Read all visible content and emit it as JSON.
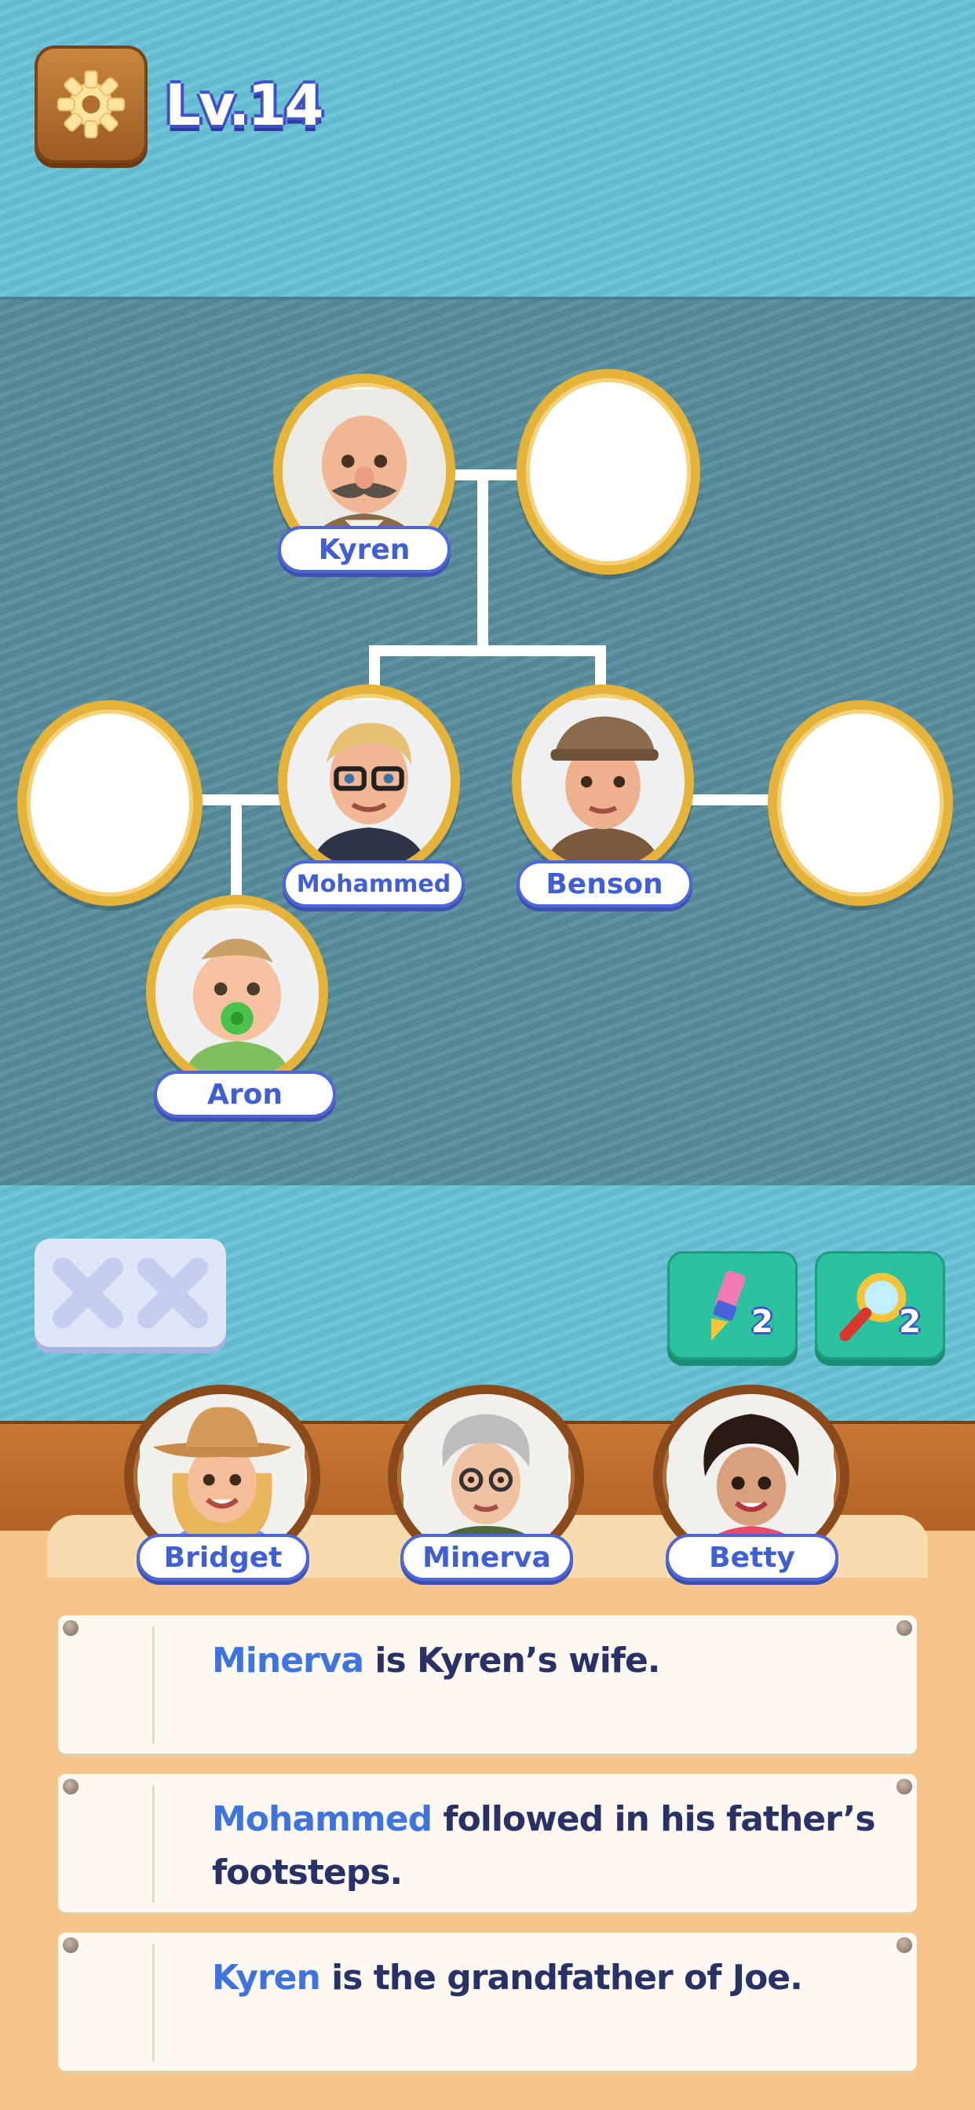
{
  "header": {
    "level": "Lv.14"
  },
  "tree": {
    "names": {
      "kyren": "Kyren",
      "mohammed": "Mohammed",
      "benson": "Benson",
      "aron": "Aron"
    }
  },
  "mistakes": {
    "marks": [
      "x",
      "x"
    ]
  },
  "tools": {
    "brush": {
      "count": "2"
    },
    "magnifier": {
      "count": "2"
    }
  },
  "candidates": [
    "Bridget",
    "Minerva",
    "Betty"
  ],
  "clues": [
    {
      "name": "Minerva",
      "rest": " is Kyren’s wife."
    },
    {
      "name": "Mohammed",
      "rest": " followed in his father’s footsteps."
    },
    {
      "name": "Kyren",
      "rest": " is the grandfather of Joe."
    }
  ],
  "colors": {
    "accent_blue": "#3f73de",
    "frame_gold": "#e5b23a",
    "tool_green": "#2cc19f"
  }
}
